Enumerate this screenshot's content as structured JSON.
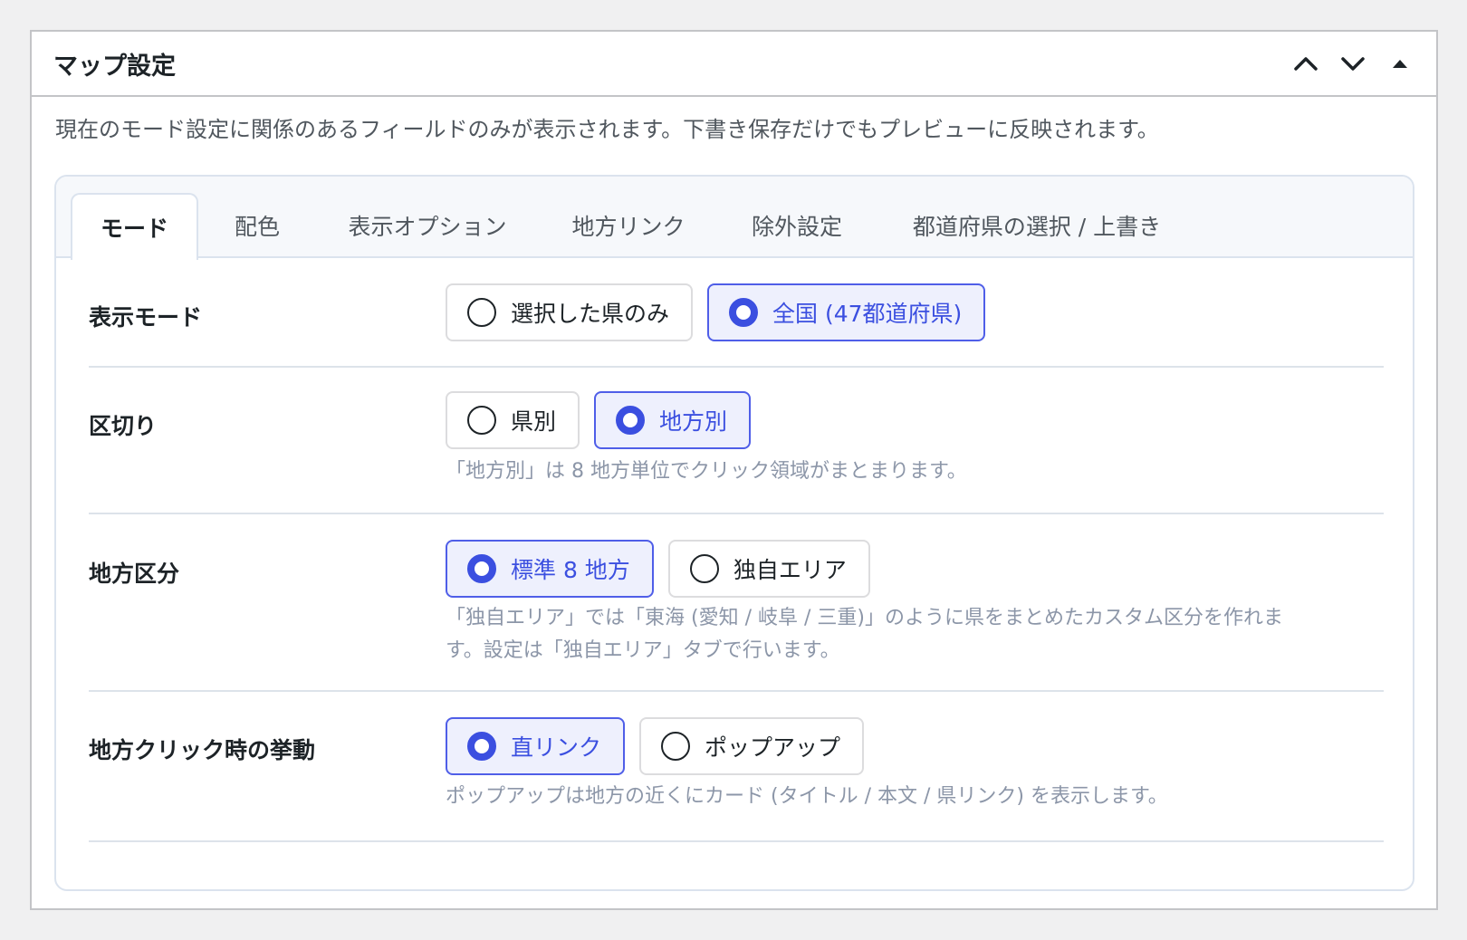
{
  "header": {
    "title": "マップ設定",
    "actions": [
      "move-up",
      "move-down",
      "toggle"
    ]
  },
  "intro": "現在のモード設定に関係のあるフィールドのみが表示されます。下書き保存だけでもプレビューに反映されます。",
  "tabs": [
    {
      "label": "モード",
      "active": true
    },
    {
      "label": "配色",
      "active": false
    },
    {
      "label": "表示オプション",
      "active": false
    },
    {
      "label": "地方リンク",
      "active": false
    },
    {
      "label": "除外設定",
      "active": false
    },
    {
      "label": "都道府県の選択 / 上書き",
      "active": false
    }
  ],
  "rows": {
    "display_mode": {
      "label": "表示モード",
      "options": [
        {
          "label": "選択した県のみ",
          "selected": false
        },
        {
          "label": "全国 (47都道府県)",
          "selected": true
        }
      ]
    },
    "division": {
      "label": "区切り",
      "options": [
        {
          "label": "県別",
          "selected": false
        },
        {
          "label": "地方別",
          "selected": true
        }
      ],
      "help": "「地方別」は 8 地方単位でクリック領域がまとまります。"
    },
    "region_type": {
      "label": "地方区分",
      "options": [
        {
          "label": "標準 8 地方",
          "selected": true
        },
        {
          "label": "独自エリア",
          "selected": false
        }
      ],
      "help_line1": "「独自エリア」では「東海 (愛知 / 岐阜 / 三重)」のように県をまとめたカスタム区分を作れま",
      "help_line2": "す。設定は「独自エリア」タブで行います。"
    },
    "click_behavior": {
      "label": "地方クリック時の挙動",
      "options": [
        {
          "label": "直リンク",
          "selected": true
        },
        {
          "label": "ポップアップ",
          "selected": false
        }
      ],
      "help": "ポップアップは地方の近くにカード (タイトル / 本文 / 県リンク) を表示します。"
    }
  },
  "colors": {
    "accent": "#3b4fe0",
    "selected_bg": "#eef0fd",
    "help_text": "#8c96a8"
  }
}
